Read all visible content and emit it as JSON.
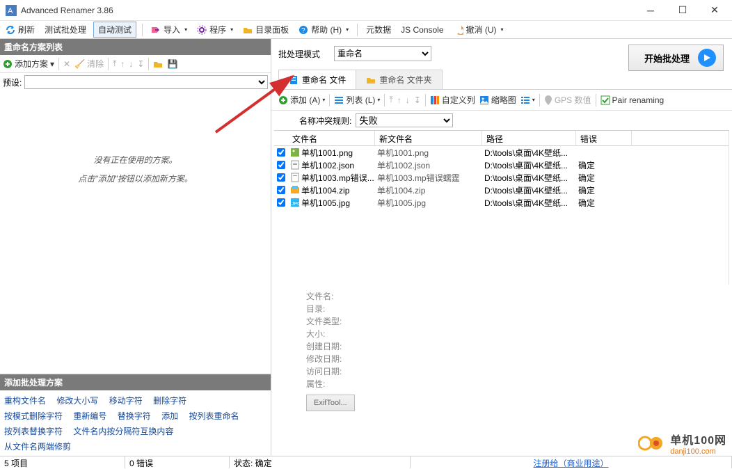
{
  "title": "Advanced Renamer 3.86",
  "menubar": {
    "refresh": "刷新",
    "test": "测试批处理",
    "autotest": "自动测试",
    "import": "导入",
    "program": "程序",
    "folderpanel": "目录面板",
    "help": "帮助 (H)",
    "metadata": "元数据",
    "jsconsole": "JS Console",
    "undo": "撤消 (U)"
  },
  "left": {
    "header": "重命名方案列表",
    "add": "添加方案",
    "clear": "清除",
    "preset_label": "预设:",
    "msg1": "没有正在使用的方案。",
    "msg2": "点击\"添加\"按钮以添加新方案。",
    "bottom_header": "添加批处理方案",
    "links_row1": [
      "重构文件名",
      "修改大小写",
      "移动字符",
      "删除字符"
    ],
    "links_row2": [
      "按模式删除字符",
      "重新编号",
      "替换字符",
      "添加",
      "按列表重命名"
    ],
    "links_row3": [
      "按列表替换字符",
      "文件名内按分隔符互换内容"
    ],
    "links_row4": [
      "从文件名两端修剪"
    ]
  },
  "right": {
    "mode_label": "批处理模式",
    "mode_value": "重命名",
    "start_label": "开始批处理",
    "tab_files": "重命名 文件",
    "tab_folders": "重命名 文件夹",
    "sub_add": "添加 (A)",
    "sub_list": "列表 (L)",
    "sub_custom": "自定义列",
    "sub_thumb": "缩略图",
    "sub_gps": "GPS 数值",
    "sub_pair": "Pair renaming",
    "conflict_label": "名称冲突规则:",
    "conflict_value": "失败"
  },
  "table": {
    "headers": {
      "name": "文件名",
      "newname": "新文件名",
      "path": "路径",
      "error": "错误"
    },
    "rows": [
      {
        "name": "单机1001.png",
        "newname": "单机1001.png",
        "path": "D:\\tools\\桌面\\4K壁纸...",
        "error": ""
      },
      {
        "name": "单机1002.json",
        "newname": "单机1002.json",
        "path": "D:\\tools\\桌面\\4K壁纸...",
        "error": "确定"
      },
      {
        "name": "单机1003.mp错误...",
        "newname": "单机1003.mp错误蠕霆",
        "path": "D:\\tools\\桌面\\4K壁纸...",
        "error": "确定"
      },
      {
        "name": "单机1004.zip",
        "newname": "单机1004.zip",
        "path": "D:\\tools\\桌面\\4K壁纸...",
        "error": "确定"
      },
      {
        "name": "单机1005.jpg",
        "newname": "单机1005.jpg",
        "path": "D:\\tools\\桌面\\4K壁纸...",
        "error": "确定"
      }
    ]
  },
  "details": {
    "filename": "文件名:",
    "dir": "目录:",
    "filetype": "文件类型:",
    "size": "大小:",
    "created": "创建日期:",
    "modified": "修改日期:",
    "accessed": "访问日期:",
    "attrs": "属性:",
    "exif": "ExifTool..."
  },
  "statusbar": {
    "count": "5 项目",
    "errors": "0 错误",
    "state": "状态: 确定",
    "register": "注册给（商业用途）"
  },
  "watermark": {
    "name": "单机100网",
    "url": "danji100.com"
  }
}
